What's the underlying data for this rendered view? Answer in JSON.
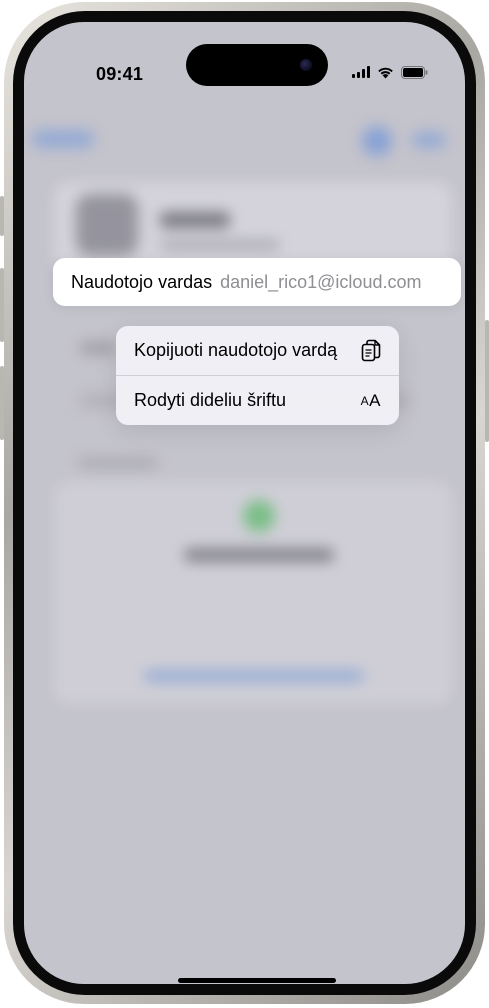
{
  "status_bar": {
    "time": "09:41",
    "icons": [
      "cellular-signal-icon",
      "wifi-icon",
      "battery-icon"
    ]
  },
  "username_field": {
    "label": "Naudotojo vardas",
    "value": "daniel_rico1@icloud.com"
  },
  "context_menu": {
    "items": [
      {
        "label": "Kopijuoti naudotojo vardą",
        "icon": "copy-icon"
      },
      {
        "label": "Rodyti dideliu šriftu",
        "icon": "text-size-icon",
        "icon_text": "AA"
      }
    ]
  },
  "colors": {
    "screen_background": "#c9c8cf",
    "pill_background": "#ffffff",
    "menu_background": "#f2f1f6",
    "secondary_text": "#8e8e93",
    "frame_titanium": "#a9a7a2"
  }
}
